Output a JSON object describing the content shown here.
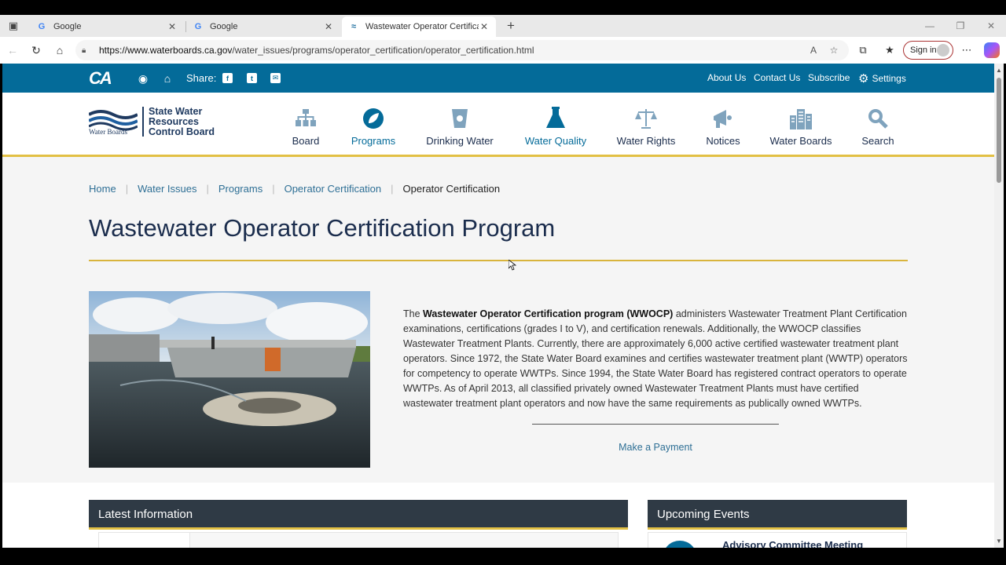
{
  "browser": {
    "tabs": [
      {
        "title": "Google",
        "favicon": "google-icon",
        "active": false
      },
      {
        "title": "Google",
        "favicon": "google-icon",
        "active": false
      },
      {
        "title": "Wastewater Operator Certification",
        "favicon": "water-boards-icon",
        "active": true
      }
    ],
    "url_domain": "https://www.waterboards.ca.gov",
    "url_path": "/water_issues/programs/operator_certification/operator_certification.html",
    "signin_label": "Sign in"
  },
  "utility": {
    "share_label": "Share:",
    "links": [
      "About Us",
      "Contact Us",
      "Subscribe"
    ],
    "settings_label": "Settings"
  },
  "header": {
    "logo_small": "CALIFORNIA",
    "logo_small2": "Water Boards",
    "logo_name": [
      "State Water",
      "Resources",
      "Control Board"
    ],
    "nav": [
      {
        "label": "Board",
        "icon": "org-chart-icon",
        "color": "#7fa3bd"
      },
      {
        "label": "Programs",
        "icon": "leaf-icon",
        "color": "#046b99"
      },
      {
        "label": "Drinking Water",
        "icon": "glass-icon",
        "color": "#7fa3bd"
      },
      {
        "label": "Water Quality",
        "icon": "flask-icon",
        "color": "#046b99"
      },
      {
        "label": "Water Rights",
        "icon": "scales-icon",
        "color": "#7fa3bd"
      },
      {
        "label": "Notices",
        "icon": "megaphone-icon",
        "color": "#7fa3bd"
      },
      {
        "label": "Water Boards",
        "icon": "buildings-icon",
        "color": "#7fa3bd"
      },
      {
        "label": "Search",
        "icon": "search-icon",
        "color": "#7fa3bd"
      }
    ]
  },
  "breadcrumb": {
    "items": [
      "Home",
      "Water Issues",
      "Programs",
      "Operator Certification"
    ],
    "current": "Operator Certification"
  },
  "page": {
    "title": "Wastewater Operator Certification Program",
    "intro_prefix": "The ",
    "intro_bold": "Wastewater Operator Certification program (WWOCP)",
    "intro_rest": " administers Wastewater Treatment Plant Certification examinations, certifications (grades I to V), and certification renewals. Additionally, the WWOCP classifies Wastewater Treatment Plants. Currently, there are approximately 6,000 active certified wastewater treatment plant operators. Since 1972, the State Water Board examines and certifies wastewater treatment plant (WWTP) operators for competency to operate WWTPs. Since 1994, the State Water Board has registered contract operators to operate WWTPs. As of April 2013, all classified privately owned Wastewater Treatment Plants must have certified wastewater treatment plant operators and now have the same requirements as publically owned WWTPs.",
    "payment_link": "Make a Payment"
  },
  "panels": {
    "latest": "Latest Information",
    "events": "Upcoming Events",
    "event_title": "Advisory Committee Meeting"
  },
  "colors": {
    "brand_blue": "#046b99",
    "gold": "#e2c044",
    "dark_navy": "#1b2d4d"
  }
}
